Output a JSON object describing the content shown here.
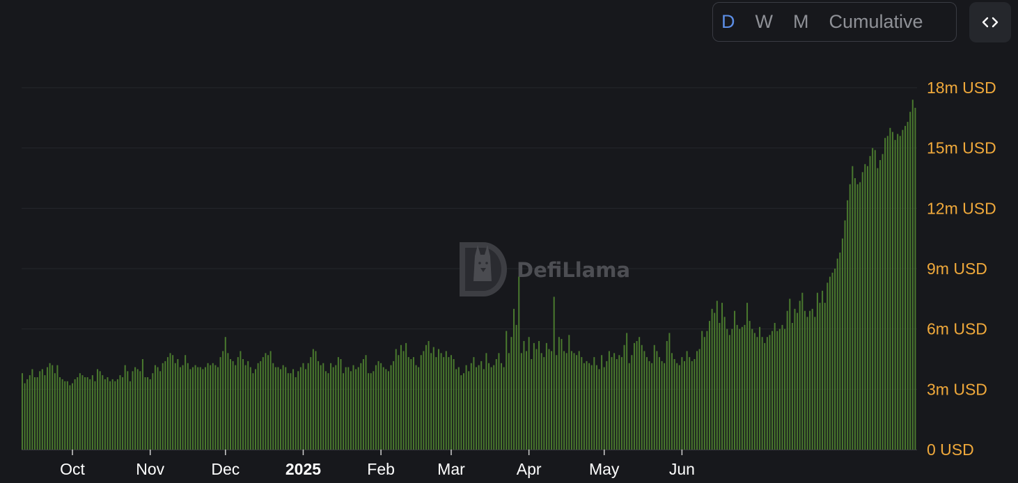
{
  "controls": {
    "tabs": [
      {
        "label": "D",
        "active": true
      },
      {
        "label": "W",
        "active": false
      },
      {
        "label": "M",
        "active": false
      },
      {
        "label": "Cumulative",
        "active": false
      }
    ],
    "embed_icon": "code-brackets-icon"
  },
  "watermark": {
    "text": "DefiLlama",
    "icon": "llama-logo"
  },
  "colors": {
    "background": "#17181c",
    "bar": "#4a7a2e",
    "y_tick": "#f0a93b",
    "x_tick": "#ffffff",
    "active_tab": "#5c8ee6",
    "inactive_tab": "#8f9197"
  },
  "chart_data": {
    "type": "bar",
    "frequency": "daily",
    "y_unit": "USD",
    "ylim": [
      0,
      18000000
    ],
    "y_ticks": [
      "0 USD",
      "3m USD",
      "6m USD",
      "9m USD",
      "12m USD",
      "15m USD",
      "18m USD"
    ],
    "x_ticks": [
      {
        "label": "Oct",
        "bold": false
      },
      {
        "label": "Nov",
        "bold": false
      },
      {
        "label": "Dec",
        "bold": false
      },
      {
        "label": "2025",
        "bold": true
      },
      {
        "label": "Feb",
        "bold": false
      },
      {
        "label": "Mar",
        "bold": false
      },
      {
        "label": "Apr",
        "bold": false
      },
      {
        "label": "May",
        "bold": false
      },
      {
        "label": "Jun",
        "bold": false
      }
    ],
    "legend": "none",
    "grid": true,
    "series": [
      {
        "values_musd": [
          3.8,
          3.3,
          3.5,
          3.7,
          4.0,
          3.6,
          3.6,
          3.9,
          4.0,
          3.7,
          4.1,
          4.3,
          4.2,
          3.8,
          4.2,
          3.6,
          3.5,
          3.4,
          3.4,
          3.2,
          3.3,
          3.5,
          3.6,
          3.8,
          3.7,
          3.6,
          3.6,
          3.5,
          3.7,
          3.4,
          4.0,
          3.9,
          3.7,
          3.5,
          3.6,
          3.4,
          3.5,
          3.4,
          3.5,
          3.7,
          3.6,
          4.2,
          3.9,
          3.4,
          3.9,
          4.1,
          4.0,
          3.9,
          4.5,
          3.6,
          3.6,
          3.5,
          3.8,
          4.2,
          4.1,
          3.9,
          4.3,
          4.4,
          4.6,
          4.8,
          4.7,
          4.3,
          4.5,
          4.1,
          4.2,
          4.7,
          4.3,
          4.0,
          4.1,
          4.2,
          4.1,
          4.1,
          4.0,
          4.1,
          4.3,
          4.2,
          4.3,
          4.2,
          4.1,
          4.6,
          4.9,
          5.6,
          4.8,
          4.5,
          4.4,
          4.2,
          4.6,
          4.9,
          4.5,
          4.2,
          4.4,
          4.1,
          3.8,
          4.0,
          4.3,
          4.4,
          4.6,
          4.8,
          4.7,
          4.9,
          4.3,
          4.1,
          4.1,
          4.0,
          4.2,
          4.1,
          3.8,
          3.8,
          4.0,
          3.6,
          3.9,
          4.1,
          4.3,
          4.0,
          4.3,
          4.6,
          5.0,
          4.9,
          4.4,
          4.2,
          4.3,
          3.9,
          3.8,
          4.3,
          4.1,
          4.2,
          4.6,
          4.5,
          3.8,
          4.1,
          4.1,
          3.9,
          4.2,
          4.0,
          4.1,
          4.3,
          4.5,
          4.7,
          3.8,
          3.8,
          3.9,
          4.2,
          4.4,
          4.3,
          4.1,
          4.0,
          3.9,
          4.2,
          4.4,
          5.0,
          4.7,
          5.2,
          4.9,
          5.3,
          4.6,
          4.5,
          4.6,
          4.2,
          4.1,
          4.7,
          4.9,
          5.2,
          5.4,
          4.8,
          5.1,
          4.6,
          5.0,
          4.8,
          4.6,
          4.9,
          4.6,
          4.7,
          4.5,
          4.0,
          4.1,
          3.7,
          3.8,
          4.2,
          3.9,
          4.3,
          4.6,
          4.1,
          4.2,
          4.4,
          4.0,
          4.8,
          4.3,
          4.1,
          4.2,
          4.5,
          4.8,
          4.3,
          4.1,
          5.9,
          4.8,
          5.6,
          7.0,
          6.2,
          8.6,
          4.8,
          5.4,
          4.9,
          5.6,
          4.5,
          5.3,
          5.0,
          5.4,
          4.8,
          4.6,
          5.3,
          5.0,
          4.9,
          7.6,
          4.7,
          5.6,
          5.5,
          4.9,
          4.8,
          5.7,
          4.9,
          4.8,
          4.7,
          4.9,
          4.6,
          4.3,
          4.4,
          4.3,
          4.2,
          4.6,
          4.2,
          4.0,
          4.7,
          4.1,
          4.4,
          4.9,
          4.6,
          4.8,
          4.5,
          4.7,
          4.6,
          5.2,
          5.8,
          4.3,
          4.7,
          5.3,
          5.4,
          5.6,
          5.2,
          4.9,
          4.6,
          4.4,
          4.3,
          5.2,
          4.9,
          4.6,
          4.4,
          4.3,
          5.4,
          5.8,
          4.8,
          4.5,
          4.3,
          4.2,
          4.6,
          4.4,
          4.9,
          4.6,
          4.4,
          4.5,
          4.9,
          5.0,
          5.9,
          5.6,
          5.9,
          6.4,
          7.0,
          6.8,
          7.4,
          6.3,
          7.3,
          6.6,
          6.0,
          5.7,
          6.0,
          6.9,
          6.2,
          6.0,
          6.1,
          6.2,
          7.3,
          6.4,
          6.0,
          5.8,
          5.6,
          6.1,
          5.6,
          5.3,
          5.6,
          5.7,
          5.9,
          6.3,
          5.9,
          6.0,
          6.2,
          6.0,
          6.9,
          7.5,
          6.3,
          7.0,
          6.8,
          7.4,
          7.8,
          6.9,
          6.6,
          6.9,
          7.0,
          6.6,
          7.8,
          7.3,
          7.9,
          7.3,
          8.3,
          8.6,
          8.8,
          9.0,
          9.5,
          9.8,
          10.5,
          11.4,
          12.4,
          13.2,
          14.1,
          13.5,
          13.2,
          13.3,
          13.8,
          14.2,
          14.1,
          14.6,
          15.0,
          14.9,
          14.0,
          14.4,
          14.7,
          15.5,
          15.6,
          16.0,
          15.8,
          15.4,
          15.7,
          15.6,
          15.9,
          16.1,
          16.3,
          16.8,
          17.4,
          17.0
        ]
      }
    ]
  }
}
